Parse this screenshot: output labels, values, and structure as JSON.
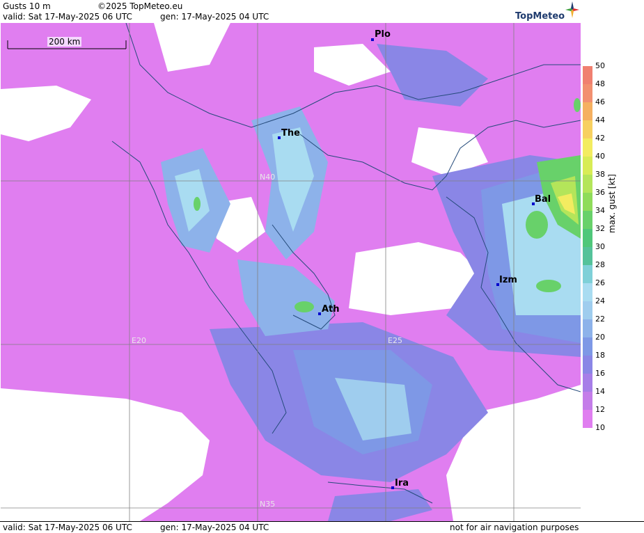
{
  "header": {
    "title": "Gusts 10 m",
    "copyright": "©2025 TopMeteo.eu",
    "valid": "valid:  Sat  17-May-2025  06 UTC",
    "gen": "gen: 17-May-2025 04 UTC",
    "brand": "TopMeteo"
  },
  "map": {
    "scale_label": "200 km",
    "cities": [
      {
        "label": "Plo"
      },
      {
        "label": "The"
      },
      {
        "label": "Bal"
      },
      {
        "label": "Izm"
      },
      {
        "label": "Ath"
      },
      {
        "label": "Ira"
      }
    ],
    "grid_labels": [
      "N40",
      "E20",
      "E25",
      "N35"
    ]
  },
  "legend": {
    "unit": "max. gust  [kt]",
    "ticks": [
      "50",
      "48",
      "46",
      "44",
      "42",
      "40",
      "38",
      "36",
      "34",
      "32",
      "30",
      "28",
      "26",
      "24",
      "22",
      "20",
      "18",
      "16",
      "14",
      "12",
      "10"
    ],
    "colors": [
      "#f08070",
      "#f29070",
      "#f5b060",
      "#f7d060",
      "#f3ec60",
      "#d8ec55",
      "#b4e55a",
      "#8fdc5a",
      "#68d16a",
      "#4fc77a",
      "#54c29a",
      "#7fd0d8",
      "#a9dcf1",
      "#9fcdee",
      "#8db2ea",
      "#7e98e6",
      "#8a86e6",
      "#a77ee8",
      "#c47de9",
      "#e07ef0"
    ]
  },
  "footer": {
    "valid": "valid:  Sat  17-May-2025  06 UTC",
    "gen": "gen: 17-May-2025 04 UTC",
    "disclaimer": "not for air navigation purposes"
  }
}
